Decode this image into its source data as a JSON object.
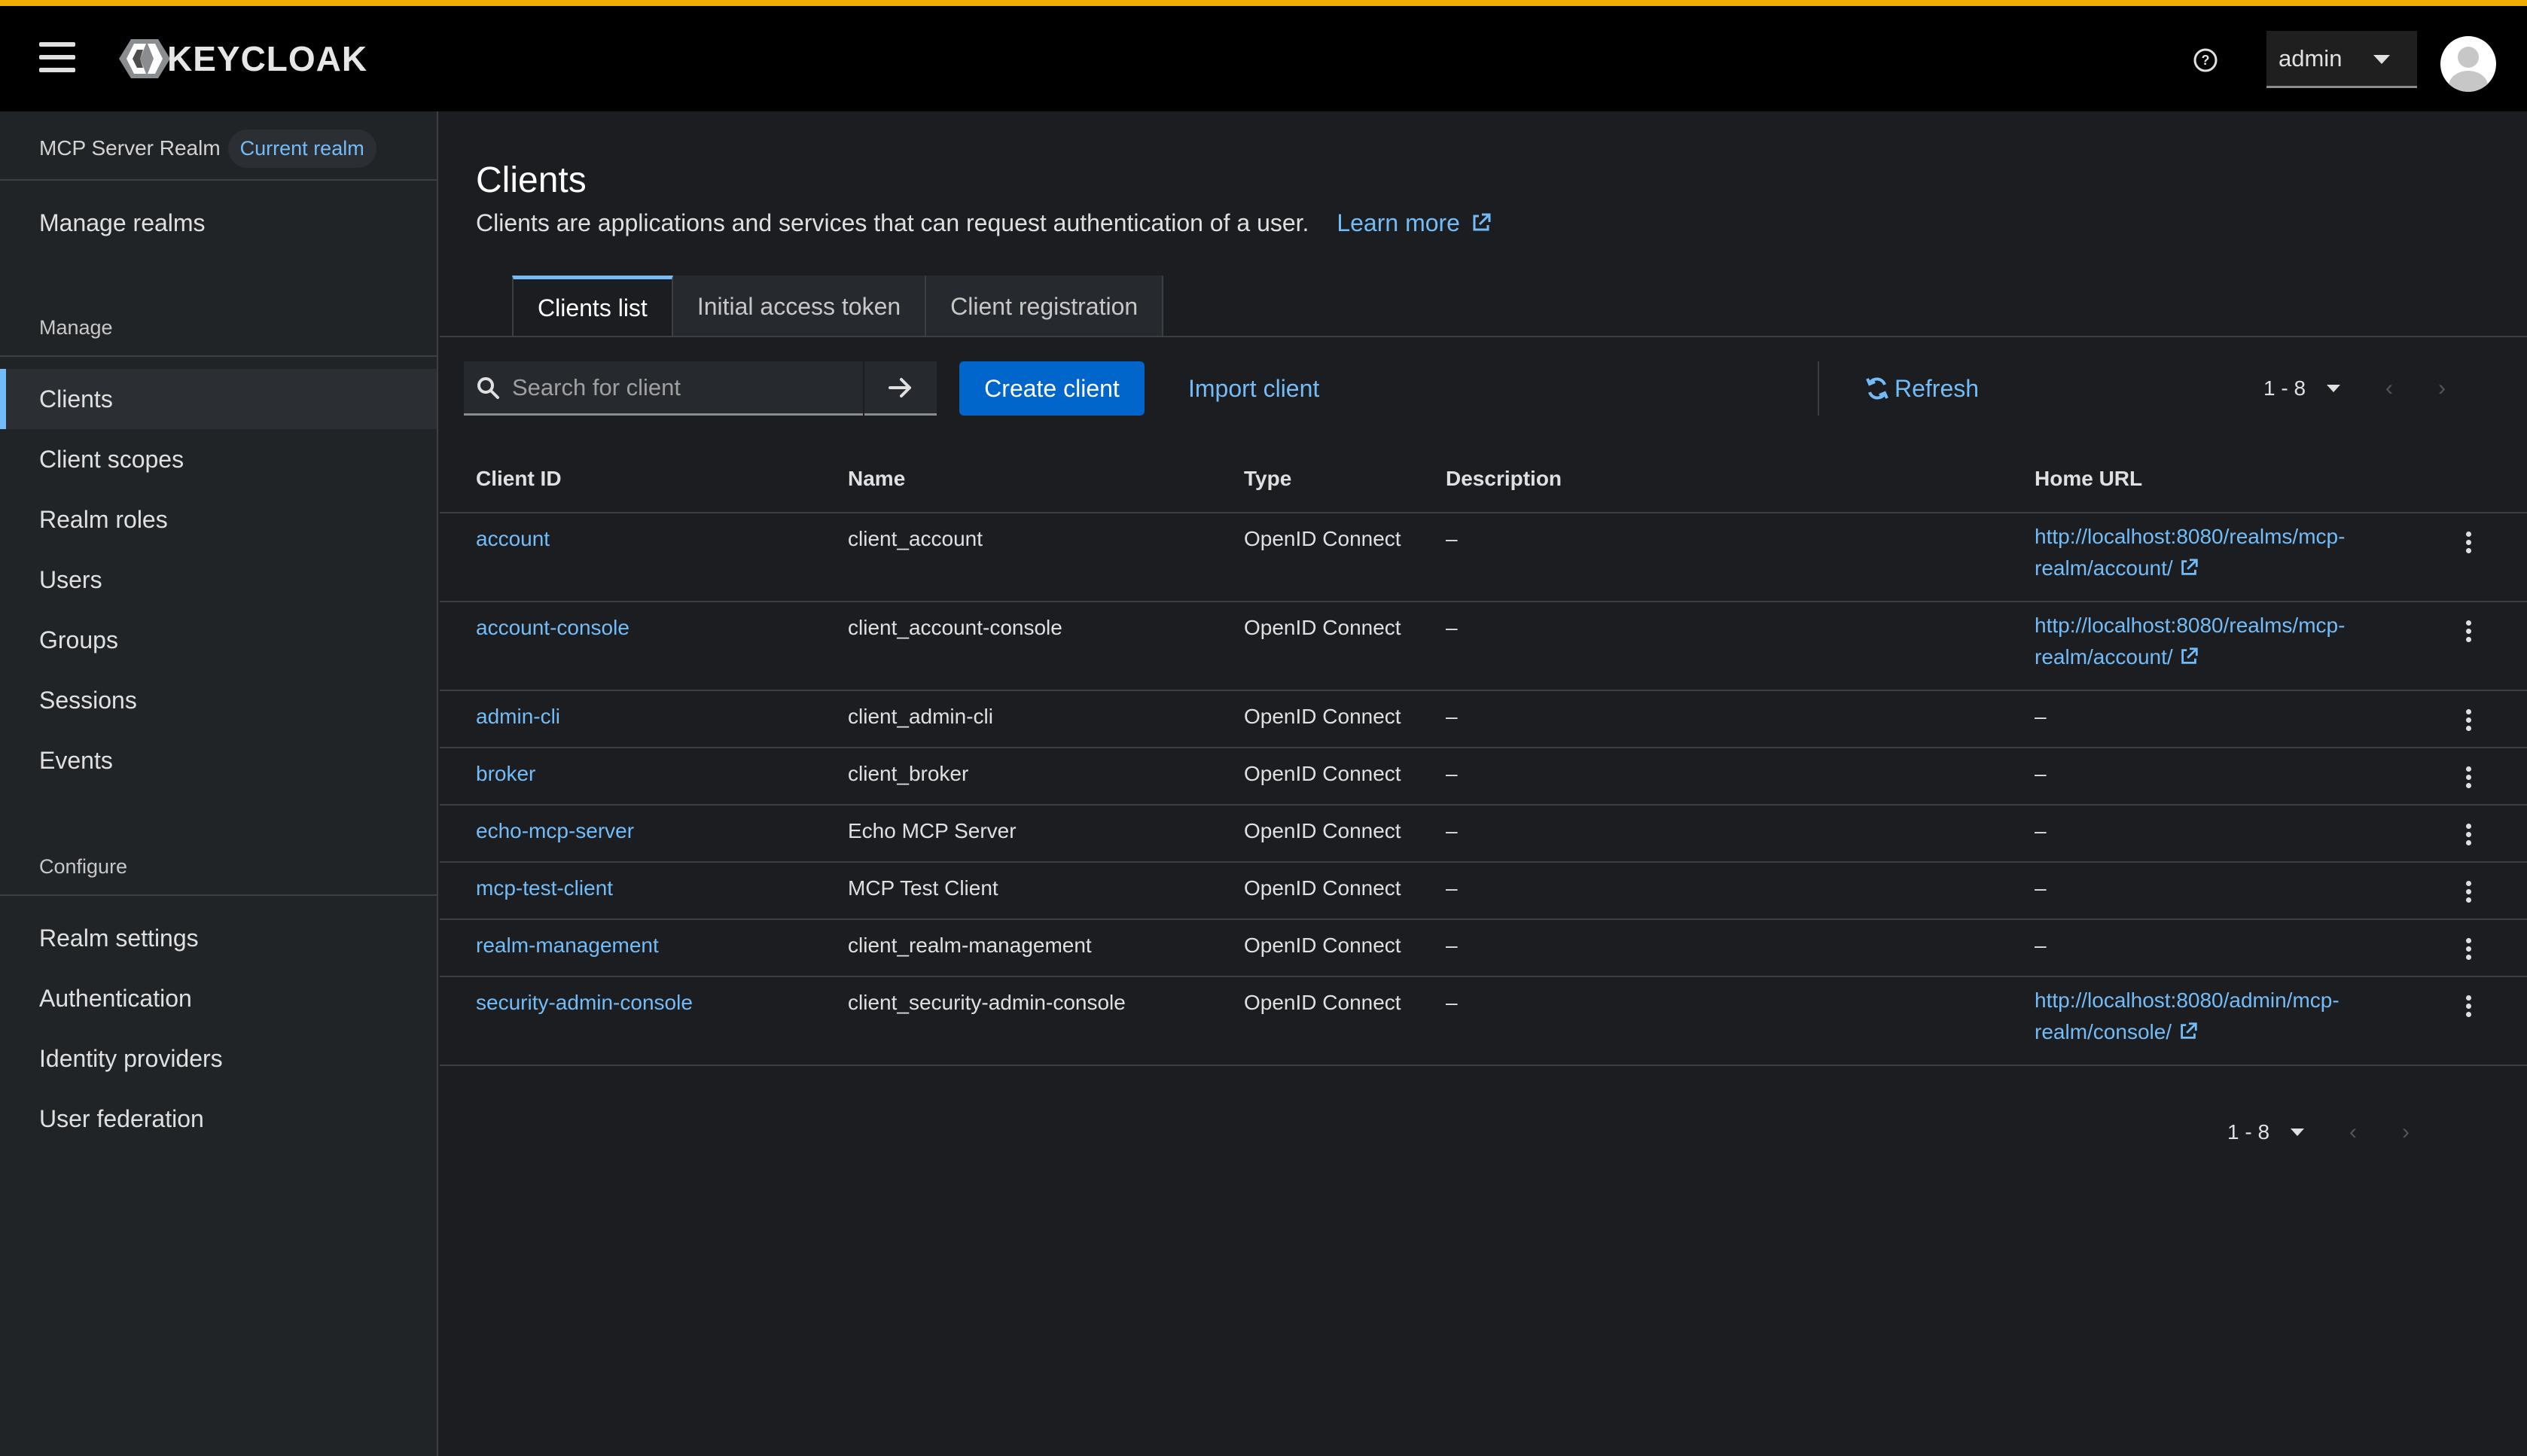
{
  "header": {
    "brand": "KEYCLOAK",
    "user": "admin"
  },
  "sidebar": {
    "realm_name": "MCP Server Realm",
    "realm_badge": "Current realm",
    "manage_realms": "Manage realms",
    "manage_heading": "Manage",
    "manage_items": [
      "Clients",
      "Client scopes",
      "Realm roles",
      "Users",
      "Groups",
      "Sessions",
      "Events"
    ],
    "configure_heading": "Configure",
    "configure_items": [
      "Realm settings",
      "Authentication",
      "Identity providers",
      "User federation"
    ]
  },
  "page": {
    "title": "Clients",
    "description": "Clients are applications and services that can request authentication of a user.",
    "learn_more": "Learn more"
  },
  "tabs": [
    "Clients list",
    "Initial access token",
    "Client registration"
  ],
  "toolbar": {
    "search_placeholder": "Search for client",
    "create_client": "Create client",
    "import_client": "Import client",
    "refresh": "Refresh",
    "pagination": "1 - 8"
  },
  "table": {
    "columns": [
      "Client ID",
      "Name",
      "Type",
      "Description",
      "Home URL"
    ],
    "rows": [
      {
        "client_id": "account",
        "name": "client_account",
        "type": "OpenID Connect",
        "description": "–",
        "home_url_1": "http://localhost:8080/realms/mcp-",
        "home_url_2": "realm/account/"
      },
      {
        "client_id": "account-console",
        "name": "client_account-console",
        "type": "OpenID Connect",
        "description": "–",
        "home_url_1": "http://localhost:8080/realms/mcp-",
        "home_url_2": "realm/account/"
      },
      {
        "client_id": "admin-cli",
        "name": "client_admin-cli",
        "type": "OpenID Connect",
        "description": "–",
        "home_url": "–"
      },
      {
        "client_id": "broker",
        "name": "client_broker",
        "type": "OpenID Connect",
        "description": "–",
        "home_url": "–"
      },
      {
        "client_id": "echo-mcp-server",
        "name": "Echo MCP Server",
        "type": "OpenID Connect",
        "description": "–",
        "home_url": "–"
      },
      {
        "client_id": "mcp-test-client",
        "name": "MCP Test Client",
        "type": "OpenID Connect",
        "description": "–",
        "home_url": "–"
      },
      {
        "client_id": "realm-management",
        "name": "client_realm-management",
        "type": "OpenID Connect",
        "description": "–",
        "home_url": "–"
      },
      {
        "client_id": "security-admin-console",
        "name": "client_security-admin-console",
        "type": "OpenID Connect",
        "description": "–",
        "home_url_1": "http://localhost:8080/admin/mcp-",
        "home_url_2": "realm/console/"
      }
    ]
  },
  "bottom_pagination": "1 - 8",
  "colors": {
    "accent": "#73bcf7",
    "primary_button": "#0066cc",
    "top_border": "#f0ab00"
  },
  "icons": [
    "hamburger-icon",
    "keycloak-logo",
    "help-icon",
    "avatar-icon",
    "search-icon",
    "arrow-right-icon",
    "sync-icon",
    "external-link-icon",
    "kebab-icon",
    "chevron-left-icon",
    "chevron-right-icon"
  ]
}
